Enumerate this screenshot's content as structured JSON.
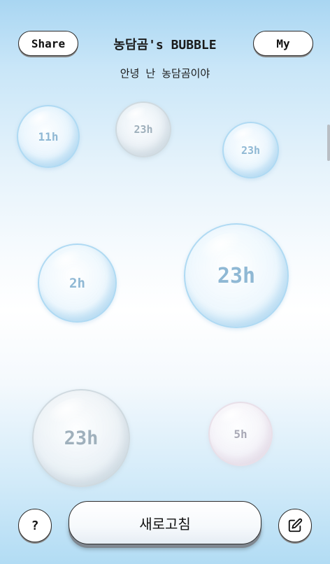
{
  "header": {
    "share_label": "Share",
    "my_label": "My",
    "title": "농담곰's BUBBLE",
    "subtitle": "안녕 난 농담곰이야"
  },
  "bubbles": [
    {
      "label": "11h",
      "tint": "blue"
    },
    {
      "label": "23h",
      "tint": "gray"
    },
    {
      "label": "23h",
      "tint": "blue"
    },
    {
      "label": "2h",
      "tint": "blue"
    },
    {
      "label": "23h",
      "tint": "blue"
    },
    {
      "label": "23h",
      "tint": "gray"
    },
    {
      "label": "5h",
      "tint": "pink"
    }
  ],
  "footer": {
    "help_label": "?",
    "refresh_label": "새로고침",
    "edit_icon": "pencil-square-icon"
  },
  "colors": {
    "bubble_blue_text": "#8fb8d4",
    "bubble_gray_text": "#9fb0bc",
    "background_top": "#a9d6f2",
    "background_mid": "#ffffff"
  }
}
